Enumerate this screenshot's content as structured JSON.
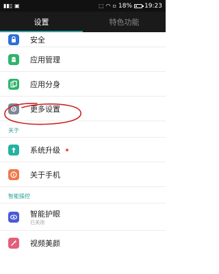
{
  "status_bar": {
    "left_icons": [
      "signal-icon",
      "image-icon"
    ],
    "battery_percent": "18%",
    "battery_level": 0.18,
    "time": "19:23"
  },
  "tabs": [
    {
      "label": "设置",
      "active": true
    },
    {
      "label": "特色功能",
      "active": false
    }
  ],
  "items_top": [
    {
      "label": "安全",
      "icon": "shield-icon",
      "color": "#2f6fd6"
    },
    {
      "label": "应用管理",
      "icon": "android-icon",
      "color": "#2fb36b"
    },
    {
      "label": "应用分身",
      "icon": "clone-icon",
      "color": "#2fb36b"
    },
    {
      "label": "更多设置",
      "icon": "gear-icon",
      "color": "#7d8796"
    }
  ],
  "section_about": {
    "label": "关于"
  },
  "items_about": [
    {
      "label": "系统升级",
      "icon": "upgrade-icon",
      "color": "#23b3a0",
      "has_dot": true
    },
    {
      "label": "关于手机",
      "icon": "info-icon",
      "color": "#f0794a"
    }
  ],
  "section_smart": {
    "label": "智能操控"
  },
  "items_smart": [
    {
      "label": "智能护眼",
      "sub": "已关闭",
      "icon": "eye-icon",
      "color": "#4a5bd6"
    },
    {
      "label": "视频美颜",
      "icon": "wand-icon",
      "color": "#e35f7a"
    }
  ],
  "colors": {
    "accent": "#2aa19b",
    "annotation": "#cc2222",
    "status_bar_bg": "#111111",
    "tab_bg": "#1a1a1a"
  }
}
